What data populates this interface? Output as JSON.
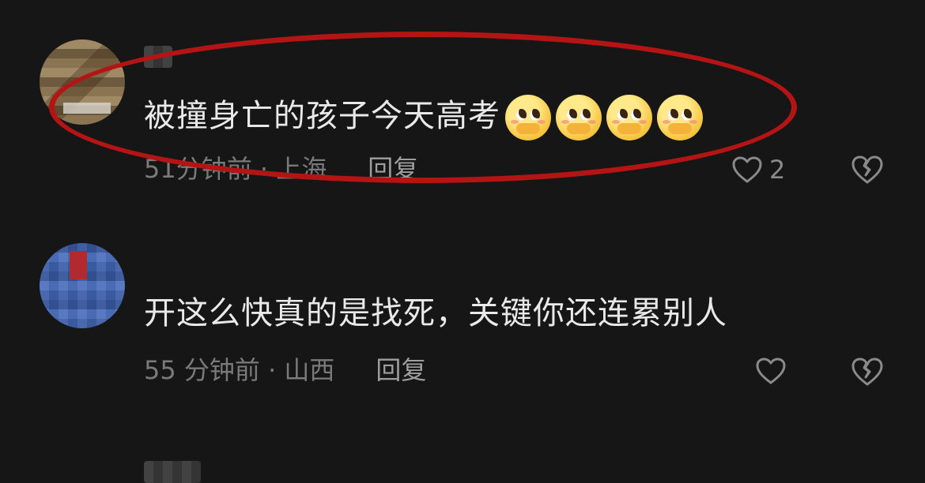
{
  "comments": [
    {
      "text": "被撞身亡的孩子今天高考",
      "emojis": [
        "pleading-face-icon",
        "pleading-face-icon",
        "pleading-face-icon",
        "pleading-face-icon"
      ],
      "time_location": "51分钟前 · 上海",
      "reply_label": "回复",
      "likes": "2"
    },
    {
      "text": "开这么快真的是找死，关键你还连累别人",
      "time_location": "55 分钟前 · 山西",
      "reply_label": "回复",
      "likes": ""
    }
  ],
  "colors": {
    "background": "#161616",
    "annotation": "#b51414",
    "secondary_text": "#7a7a7a"
  }
}
